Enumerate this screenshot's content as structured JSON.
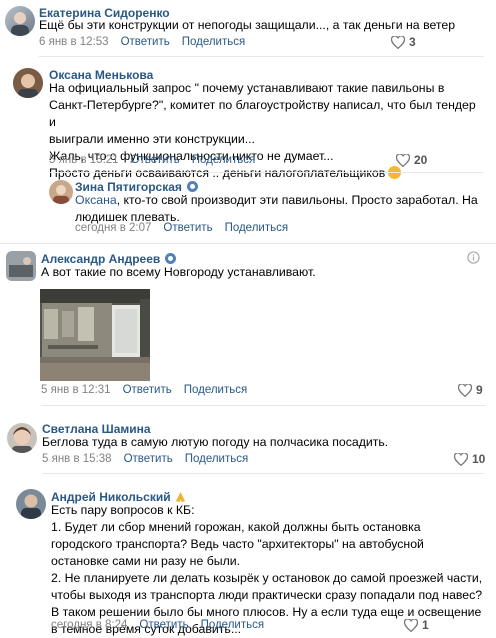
{
  "comments": [
    {
      "author": "Екатерина Сидоренко",
      "text": "Ещё бы эти конструкции от непогоды защищали..., а так деньги на ветер",
      "date": "6 янв в 12:53",
      "reply": "Ответить",
      "share": "Поделиться",
      "likes": "3"
    },
    {
      "author": "Оксана Менькова",
      "lines": [
        "На официальный запрос \" почему устанавливают такие павильоны в",
        "Санкт-Петербурге?\", комитет по благоустройству написал, что был тендер и",
        "выиграли именно эти конструкции...",
        "Жаль, что о функциональности никто не думает...",
        "Просто деньги осваиваются .. деньги налогоплательщиков"
      ],
      "date": "5 янв в 13:21",
      "reply": "Ответить",
      "share": "Поделиться",
      "likes": "20"
    },
    {
      "author": "Зина Пятигорская",
      "mention": "Оксана",
      "lines": [
        ", кто-то свой производит эти павильоны. Просто заработал. На",
        "людишек плевать."
      ],
      "date": "сегодня в 2:07",
      "reply": "Ответить",
      "share": "Поделиться"
    },
    {
      "author": "Александр Андреев",
      "text": "А вот такие по всему Новгороду устанавливают.",
      "date": "5 янв в 12:31",
      "reply": "Ответить",
      "share": "Поделиться",
      "likes": "9"
    },
    {
      "author": "Светлана Шамина",
      "text": "Беглова туда в самую лютую погоду на полчасика посадить.",
      "date": "5 янв в 15:38",
      "reply": "Ответить",
      "share": "Поделиться",
      "likes": "10"
    },
    {
      "author": "Андрей Никольский",
      "lines": [
        "Есть пару вопросов к КБ:",
        "1. Будет ли сбор мнений горожан, какой должны быть остановка",
        "городского транспорта? Ведь часто \"архитекторы\" на автобусной",
        "остановке сами ни разу не были.",
        "2. Не планируете ли делать козырёк у остановок до самой проезжей части,",
        "чтобы выходя из транспорта люди практически сразу попадали под навес?",
        "В таком решении было бы много плюсов. Ну а если туда еще и освещение",
        "в темное время суток добавить..."
      ],
      "date": "сегодня в 8:24",
      "reply": "Ответить",
      "share": "Поделиться",
      "likes": "1"
    }
  ],
  "colors": {
    "link": "#2a5885",
    "meta": "#828282",
    "badge": "#5181b8"
  },
  "icons": [
    "heart-icon",
    "info-icon",
    "verified-icon"
  ]
}
